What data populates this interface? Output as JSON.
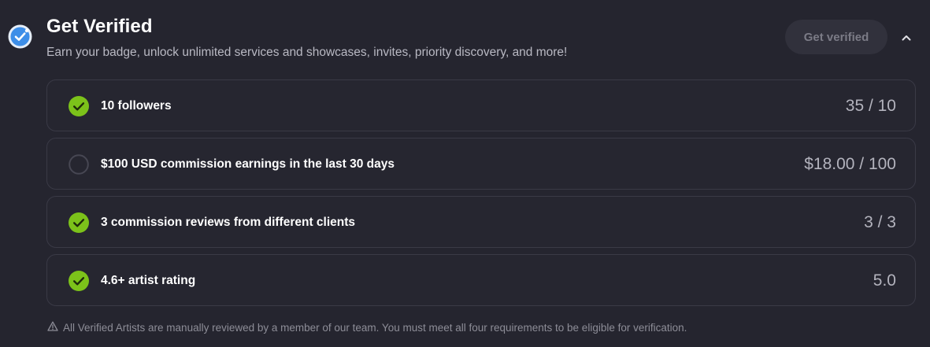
{
  "header": {
    "title": "Get Verified",
    "subtitle": "Earn your badge, unlock unlimited services and showcases, invites, priority discovery, and more!",
    "button_label": "Get verified",
    "badge_icon": "verified-badge-icon",
    "collapse_icon": "chevron-up-icon"
  },
  "requirements": [
    {
      "label": "10 followers",
      "progress": "35 / 10",
      "completed": true
    },
    {
      "label": "$100 USD commission earnings in the last 30 days",
      "progress": "$18.00 / 100",
      "completed": false
    },
    {
      "label": "3 commission reviews from different clients",
      "progress": "3 / 3",
      "completed": true
    },
    {
      "label": "4.6+ artist rating",
      "progress": "5.0",
      "completed": true
    }
  ],
  "footnote": {
    "icon": "warning-icon",
    "text": "All Verified Artists are manually reviewed by a member of our team. You must meet all four requirements to be eligible for verification."
  },
  "colors": {
    "background": "#25252f",
    "check_green": "#7cc21a",
    "badge_blue": "#3d8ee8"
  }
}
